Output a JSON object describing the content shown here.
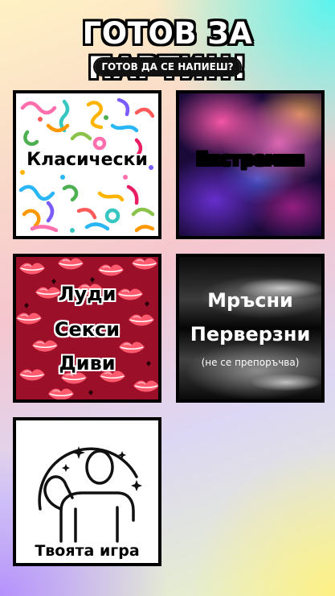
{
  "header": {
    "title": "ГОТОВ ЗА ПАРТИ!!!",
    "subtitle": "ГОТОВ ДА СЕ НАПИЕШ?"
  },
  "cards": {
    "classic": {
      "label": "Класически",
      "icon": "confetti-pattern"
    },
    "extreme": {
      "label": "Екстремни",
      "icon": "colorful-smoke-background"
    },
    "crazy": {
      "line1": "Луди",
      "line2": "Секси",
      "line3": "Диви",
      "icon": "lips-pattern"
    },
    "dirty": {
      "line1": "Мръсни",
      "line2": "Перверзни",
      "note": "(не се препоръчва)",
      "icon": "lips-photo"
    },
    "custom": {
      "label": "Твоята игра",
      "icon": "person-flexing-icon"
    }
  }
}
